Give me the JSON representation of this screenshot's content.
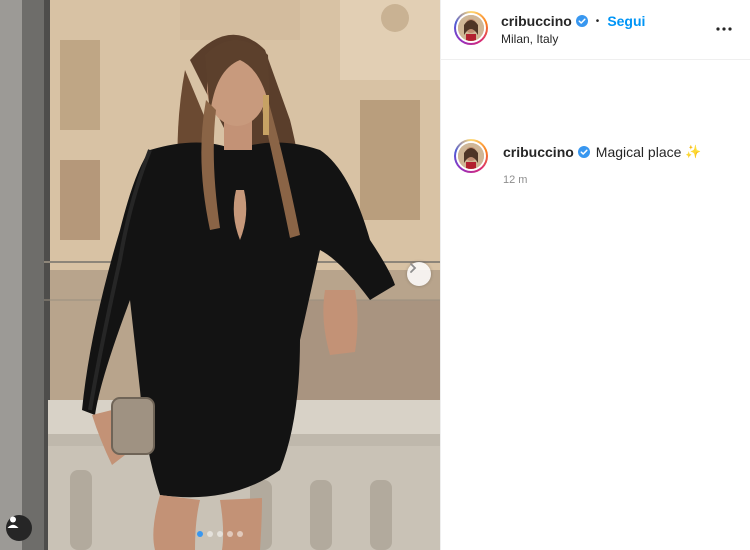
{
  "post": {
    "username": "cribuccino",
    "follow_label": "Segui",
    "separator": "•",
    "location": "Milan, Italy",
    "caption_text": "Magical place",
    "caption_emoji": "✨",
    "timestamp": "12 m",
    "carousel": {
      "slide_count": 5,
      "active_slide": 1
    }
  },
  "icons": {
    "verified": "verified-badge-icon",
    "more": "more-options-icon",
    "next": "chevron-right-icon",
    "tags": "user-tag-icon"
  },
  "colors": {
    "accent": "#0095f6",
    "verified": "#3897f0",
    "text": "#262626",
    "muted": "#8e8e8e"
  }
}
